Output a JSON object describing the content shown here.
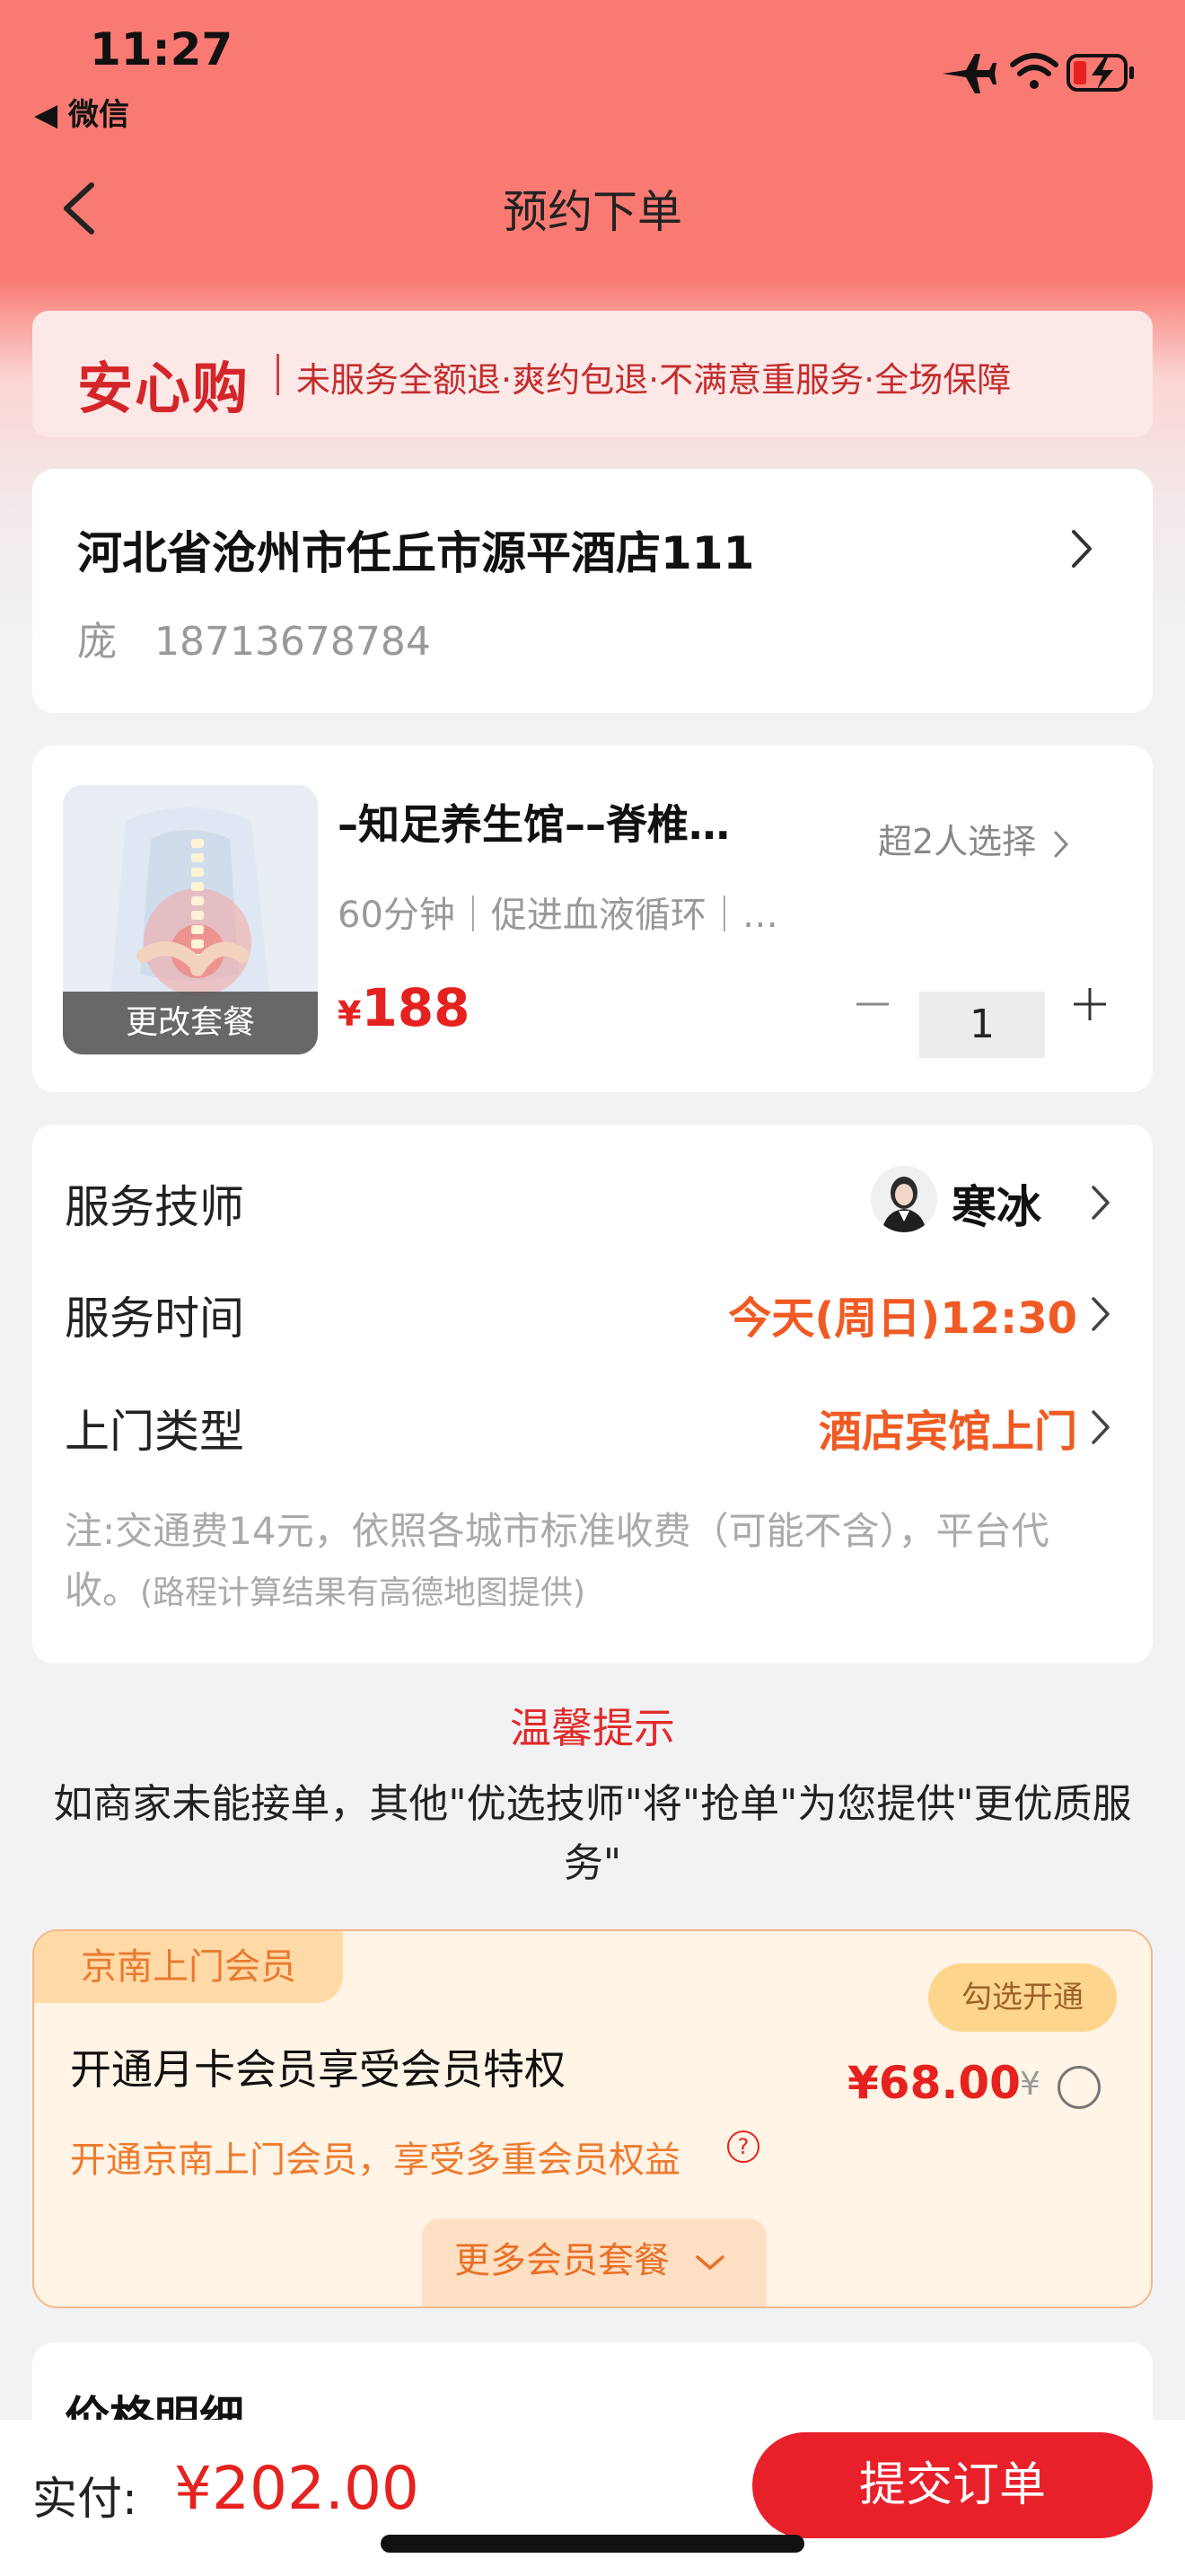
{
  "status_bar": {
    "time": "11:27",
    "back_app": "◀ 微信",
    "icons": [
      "airplane-icon",
      "wifi-icon",
      "battery-charging-icon"
    ]
  },
  "nav": {
    "title": "预约下单",
    "back_icon": "chevron-left-icon"
  },
  "guarantee": {
    "logo": "安心购",
    "text": "未服务全额退·爽约包退·不满意重服务·全场保障"
  },
  "address": {
    "text": "河北省沧州市任丘市源平酒店111",
    "contact": "庞   18713678784"
  },
  "product": {
    "title": "–知足养生馆––脊椎…",
    "selected_by": "超2人选择",
    "desc": "60分钟｜促进血液循环｜…",
    "price_currency": "¥",
    "price": "188",
    "change_label": "更改套餐",
    "quantity": "1"
  },
  "service": {
    "technician_label": "服务技师",
    "technician_name": "寒冰",
    "time_label": "服务时间",
    "time_value": "今天(周日)12:30",
    "type_label": "上门类型",
    "type_value": "酒店宾馆上门",
    "note_main": "注:交通费14元，依照各城市标准收费（可能不含），平台代收。",
    "note_small": "(路程计算结果有高德地图提供)"
  },
  "tips": {
    "title": "温馨提示",
    "text": "如商家未能接单，其他\"优选技师\"将\"抢单\"为您提供\"更优质服务\""
  },
  "membership": {
    "tag": "京南上门会员",
    "open_pill": "勾选开通",
    "title": "开通月卡会员享受会员特权",
    "price": "¥68.00",
    "yen": "¥",
    "subtitle": "开通京南上门会员，享受多重会员权益",
    "help_mark": "?",
    "more": "更多会员套餐"
  },
  "price_detail": {
    "title": "价格明细"
  },
  "bottom_bar": {
    "pay_label": "实付:",
    "pay_amount": "¥202.00",
    "submit": "提交订单"
  },
  "colors": {
    "header_red": "#f97a72",
    "accent_red": "#e5221f",
    "orange": "#f05a23",
    "submit_red": "#e8202a"
  }
}
